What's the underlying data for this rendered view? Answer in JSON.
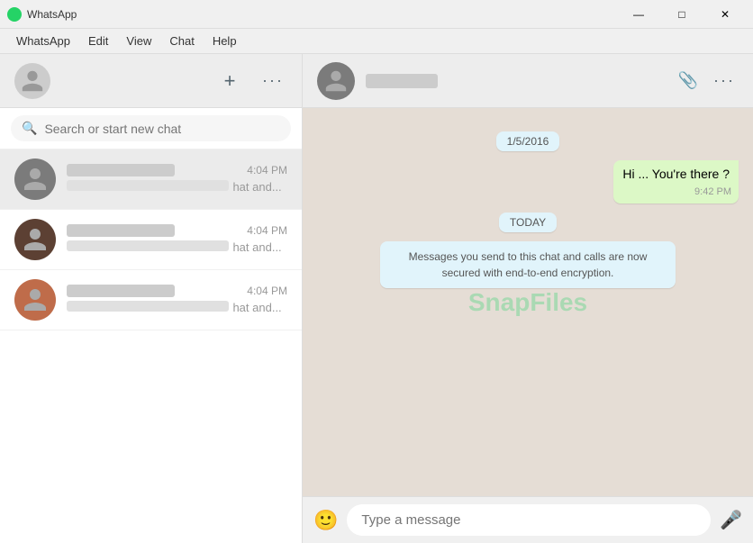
{
  "titleBar": {
    "appName": "WhatsApp",
    "minimize": "—",
    "maximize": "□",
    "close": "✕"
  },
  "menuBar": {
    "items": [
      "WhatsApp",
      "Edit",
      "View",
      "Chat",
      "Help"
    ]
  },
  "leftHeader": {
    "newChat": "+",
    "menu": "···"
  },
  "search": {
    "placeholder": "Search or start new chat"
  },
  "chatList": [
    {
      "id": 1,
      "name": "████",
      "time": "4:04 PM",
      "preview": "hat and...",
      "avatarClass": "green"
    },
    {
      "id": 2,
      "name": "██████",
      "time": "4:04 PM",
      "preview": "hat and...",
      "avatarClass": "brown"
    },
    {
      "id": 3,
      "name": "██ █████████",
      "time": "4:04 PM",
      "preview": "hat and...",
      "avatarClass": "orange"
    }
  ],
  "activeChat": {
    "name": "████",
    "dateDivider": "1/5/2016",
    "todayDivider": "TODAY"
  },
  "messages": [
    {
      "id": 1,
      "type": "sent",
      "text": "Hi ... You're there ?",
      "time": "9:42 PM"
    }
  ],
  "systemMessage": {
    "text": "Messages you send to this chat and calls are now secured with end-to-end encryption."
  },
  "inputBar": {
    "placeholder": "Type a message"
  },
  "watermark": "SnapFiles"
}
